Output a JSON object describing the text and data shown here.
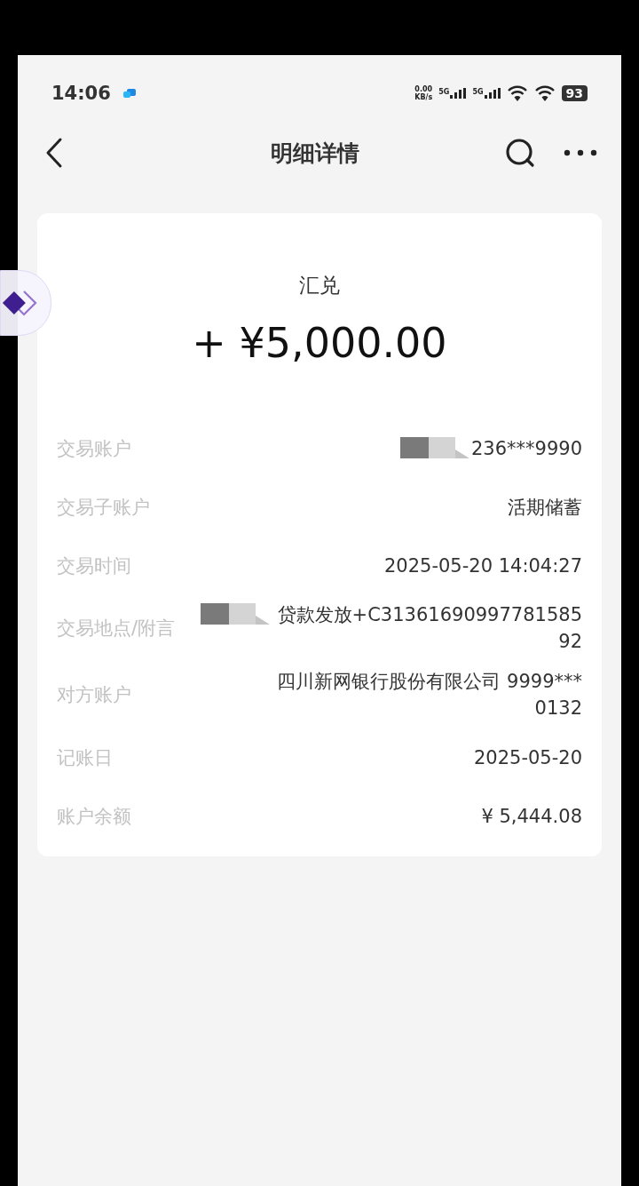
{
  "status_bar": {
    "time": "14:06",
    "net_speed_value": "0.00",
    "net_speed_unit": "KB/s",
    "signals": [
      "5G",
      "5G"
    ],
    "battery": "93"
  },
  "nav": {
    "title": "明细详情"
  },
  "summary": {
    "type_label": "汇兑",
    "amount": "+ ¥5,000.00"
  },
  "rows": [
    {
      "label": "交易账户",
      "value": "236***9990",
      "redacted": true
    },
    {
      "label": "交易子账户",
      "value": "活期储蓄",
      "redacted": false
    },
    {
      "label": "交易时间",
      "value": "2025-05-20 14:04:27",
      "redacted": false
    },
    {
      "label": "交易地点/附言",
      "value": "贷款发放+C3136169099778158592",
      "redacted": true
    },
    {
      "label": "对方账户",
      "value": "四川新网银行股份有限公司 9999***0132",
      "redacted": false
    },
    {
      "label": "记账日",
      "value": "2025-05-20",
      "redacted": false
    },
    {
      "label": "账户余额",
      "value": "¥ 5,444.08",
      "redacted": false
    }
  ]
}
